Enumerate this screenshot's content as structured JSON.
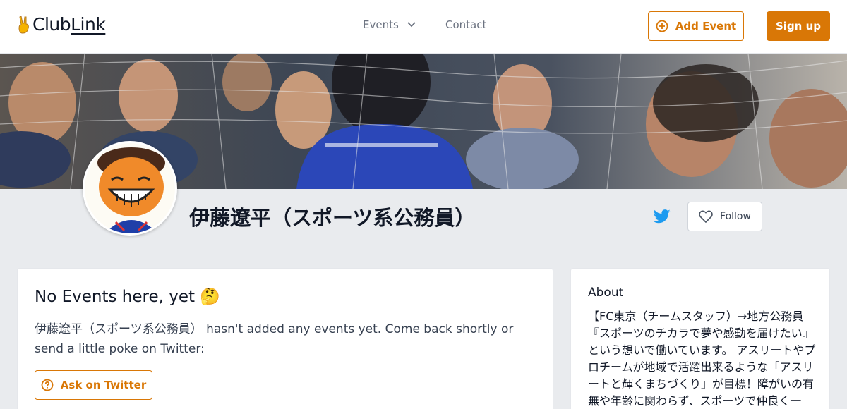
{
  "header": {
    "logo": {
      "emoji": "✌",
      "text_club": "Club",
      "text_link": "Link"
    },
    "nav": {
      "events_label": "Events",
      "contact_label": "Contact"
    },
    "add_event_label": "Add Event",
    "sign_up_label": "Sign up"
  },
  "profile": {
    "name": "伊藤遼平（スポーツ系公務員）",
    "follow_label": "Follow",
    "twitter_icon": "twitter-icon"
  },
  "events_card": {
    "title": "No Events here, yet 🤔",
    "message": "伊藤遼平（スポーツ系公務員） hasn't added any events yet. Come back shortly or send a little poke on Twitter:",
    "ask_label": "Ask on Twitter"
  },
  "about_card": {
    "title": "About",
    "text": "【FC東京（チームスタッフ）→地方公務員『スポーツのチカラで夢や感動を届けたい』という想いで働いています。 アスリートやプロチームが地域で活躍出来るような「アスリートと輝くまちづくり」が目標！障がいの有無や年齢に関わらず、スポーツで仲良く一"
  },
  "colors": {
    "accent": "#d97706",
    "twitter": "#1d9bf0",
    "page_bg": "#e9ebee"
  }
}
